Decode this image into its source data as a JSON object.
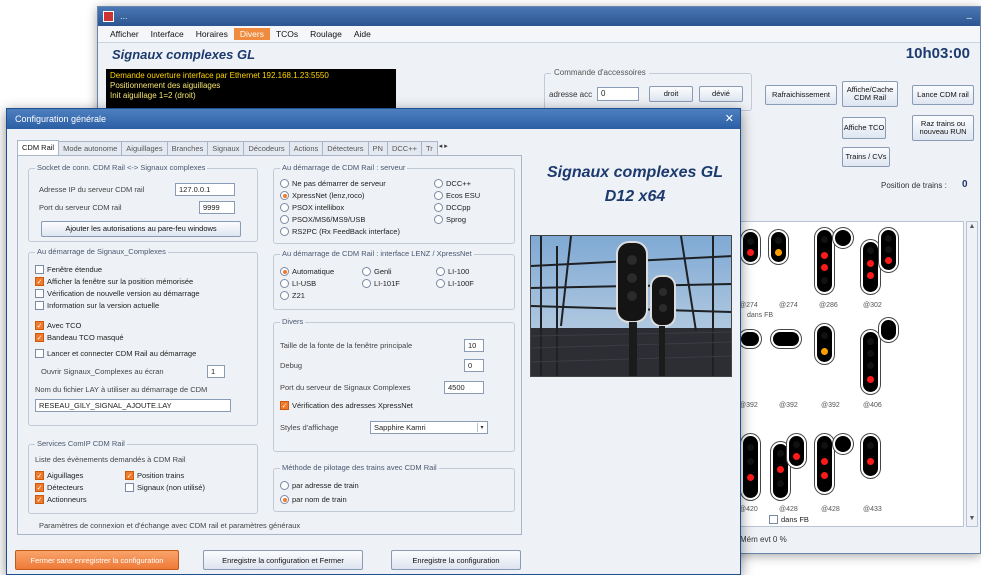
{
  "back_window": {
    "title": "...",
    "menu": [
      "Afficher",
      "Interface",
      "Horaires",
      "Divers",
      "TCOs",
      "Roulage",
      "Aide"
    ],
    "app_title": "Signaux complexes GL",
    "clock": "10h03:00",
    "console_lines": [
      "Demande ouverture interface par Ethernet 192.168.1.23:5550",
      "Positionnement des aiguillages",
      "Init aiguillage 1=2 (droit)"
    ],
    "accessory_group": {
      "caption": "Commande d'accessoires",
      "address_label": "adresse acc",
      "address_value": "0",
      "straight_label": "droit",
      "deviated_label": "dévié"
    },
    "buttons": {
      "refresh": "Rafraichissement",
      "show_hide_cdm": "Affiche/Cache CDM Rail",
      "launch_cdm": "Lance CDM rail",
      "show_tco": "Affiche TCO",
      "reset_trains": "Raz trains ou nouveau RUN",
      "trains_cvs": "Trains / CVs"
    },
    "trains_label": "Position de trains :",
    "trains_count": "0",
    "signal_labels": [
      "@274",
      "@286",
      "@302",
      "@392",
      "@406",
      "@420",
      "@428",
      "@433"
    ],
    "signal_note": "dans FB",
    "footer_status": "Mém evt 0 %"
  },
  "dialog": {
    "title": "Configuration générale",
    "close_glyph": "✕",
    "tabs": [
      "CDM Rail",
      "Mode autonome",
      "Aiguillages",
      "Branches",
      "Signaux",
      "Décodeurs",
      "Actions",
      "Détecteurs",
      "PN",
      "DCC++",
      "Tr"
    ],
    "tab_arrows": "◂ ▸",
    "socket_group": {
      "caption": "Socket de conn. CDM Rail <-> Signaux complexes",
      "ip_label": "Adresse IP du serveur CDM rail",
      "ip_value": "127.0.0.1",
      "port_label": "Port du serveur CDM rail",
      "port_value": "9999",
      "firewall_button": "Ajouter les autorisations au pare-feu windows"
    },
    "startup_group": {
      "caption": "Au démarrage de Signaux_Complexes",
      "options": [
        {
          "label": "Fenêtre étendue",
          "checked": false
        },
        {
          "label": "Afficher la fenêtre sur la position mémorisée",
          "checked": true
        },
        {
          "label": "Vérification de nouvelle version au démarrage",
          "checked": false
        },
        {
          "label": "Information sur la version actuelle",
          "checked": false
        },
        {
          "label": "Avec TCO",
          "checked": true
        },
        {
          "label": "Bandeau TCO masqué",
          "checked": true
        },
        {
          "label": "Lancer et connecter CDM Rail au démarrage",
          "checked": false
        }
      ],
      "close_after_label": "Ouvrir Signaux_Complexes au écran",
      "close_after_value": "1",
      "lay_label": "Nom du fichier LAY à utiliser au démarrage de CDM",
      "lay_value": "RESEAU_GILY_SIGNAL_AJOUTE.LAY"
    },
    "services_group": {
      "caption": "Services ComIP CDM Rail",
      "subtitle": "Liste des évènements demandés à CDM Rail",
      "options": [
        {
          "label": "Aiguillages",
          "checked": true
        },
        {
          "label": "Position trains",
          "checked": true
        },
        {
          "label": "Détecteurs",
          "checked": true
        },
        {
          "label": "Signaux (non utilisé)",
          "checked": false
        },
        {
          "label": "Actionneurs",
          "checked": true
        }
      ]
    },
    "server_group": {
      "caption": "Au démarrage de CDM Rail : serveur",
      "left": [
        {
          "label": "Ne pas démarrer de serveur",
          "on": false
        },
        {
          "label": "XpressNet (lenz,roco)",
          "on": true
        },
        {
          "label": "PSOX intellibox",
          "on": false
        },
        {
          "label": "PSOX/MS6/MS9/USB",
          "on": false
        },
        {
          "label": "RS2PC (Rx FeedBack interface)",
          "on": false
        }
      ],
      "right": [
        {
          "label": "DCC++",
          "on": false
        },
        {
          "label": "Ecos ESU",
          "on": false
        },
        {
          "label": "DCCpp",
          "on": false
        },
        {
          "label": "Sprog",
          "on": false
        }
      ]
    },
    "interface_group": {
      "caption": "Au démarrage de CDM Rail : interface LENZ / XpressNet",
      "options": [
        {
          "label": "Automatique",
          "on": true
        },
        {
          "label": "Genli",
          "on": false
        },
        {
          "label": "LI-100",
          "on": false
        },
        {
          "label": "LI-USB",
          "on": false
        },
        {
          "label": "LI-101F",
          "on": false
        },
        {
          "label": "LI-100F",
          "on": false
        },
        {
          "label": "Z21",
          "on": false
        }
      ]
    },
    "misc_group": {
      "caption": "Divers",
      "font_size_label": "Taille de la fonte de la fenêtre principale",
      "font_size_value": "10",
      "debug_label": "Debug",
      "debug_value": "0",
      "port_label": "Port du serveur de Signaux Complexes",
      "port_value": "4500",
      "xpressnet_check": "Vérification des adresses XpressNet",
      "style_label": "Styles d'affichage",
      "style_value": "Sapphire Kamri"
    },
    "pilot_group": {
      "caption": "Méthode de pilotage des trains avec CDM Rail",
      "options": [
        {
          "label": "par adresse de train",
          "on": false
        },
        {
          "label": "par nom de train",
          "on": true
        }
      ]
    },
    "footer_note": "Paramètres de connexion et d'échange avec CDM rail et paramètres généraux",
    "buttons": {
      "close_no_save": "Fermer sans enregistrer la configuration",
      "save_close": "Enregistre la configuration et Fermer",
      "save": "Enregistre la configuration"
    },
    "brand_line1": "Signaux complexes GL",
    "brand_line2": "D12 x64"
  }
}
